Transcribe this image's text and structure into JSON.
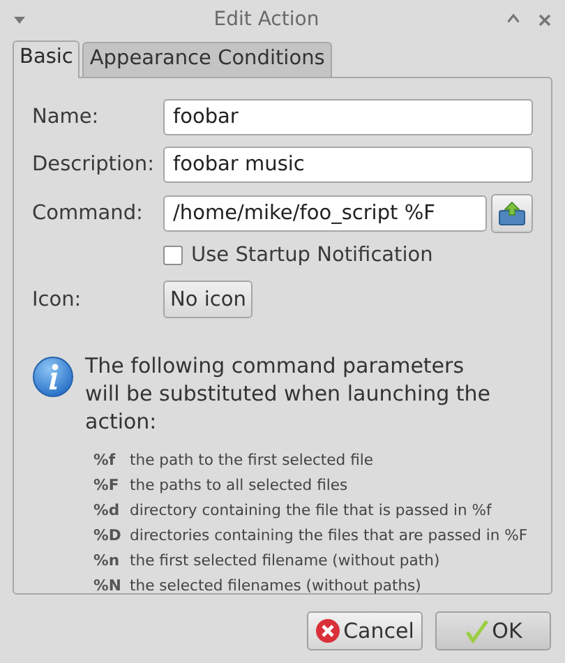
{
  "window": {
    "title": "Edit Action"
  },
  "tabs": [
    {
      "label": "Basic",
      "selected": true
    },
    {
      "label": "Appearance Conditions",
      "selected": false
    }
  ],
  "fields": [
    {
      "kind": "text",
      "label": "Name:",
      "value": "foobar"
    },
    {
      "kind": "text",
      "label": "Description:",
      "value": "foobar music"
    },
    {
      "kind": "command",
      "label": "Command:",
      "value": "/home/mike/foo_script %F"
    },
    {
      "kind": "checkbox",
      "label": "Use Startup Notification",
      "checked": false
    },
    {
      "kind": "button",
      "label": "Icon:",
      "button": "No icon"
    }
  ],
  "info": "The following command parameters will be substituted when launching the action:",
  "parameters": [
    {
      "code": "%f",
      "description": "the path to the first selected file"
    },
    {
      "code": "%F",
      "description": "the paths to all selected files"
    },
    {
      "code": "%d",
      "description": "directory containing the file that is passed in %f"
    },
    {
      "code": "%D",
      "description": "directories containing the files that are passed in %F"
    },
    {
      "code": "%n",
      "description": "the first selected filename (without path)"
    },
    {
      "code": "%N",
      "description": "the selected filenames (without paths)"
    }
  ],
  "buttons": [
    {
      "kind": "cancel",
      "label": "Cancel"
    },
    {
      "kind": "ok",
      "label": "OK"
    }
  ]
}
